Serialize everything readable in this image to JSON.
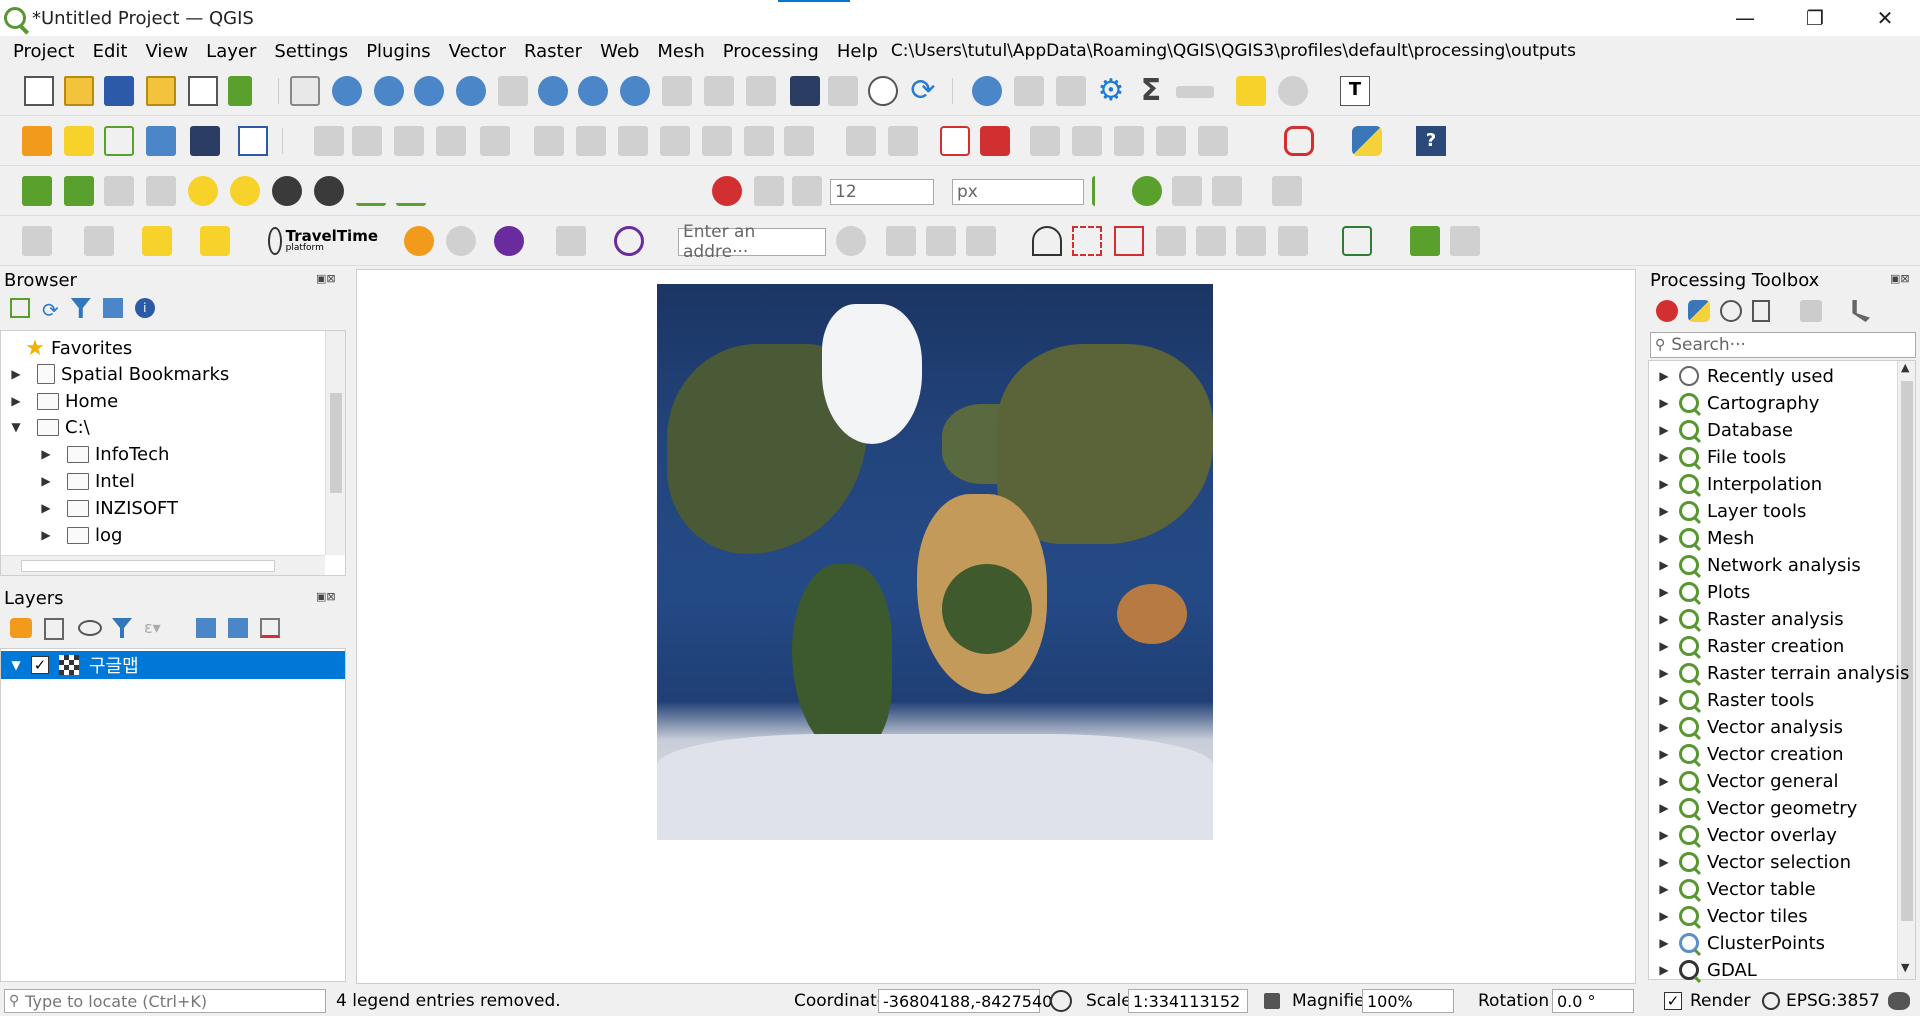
{
  "window": {
    "title": "*Untitled Project — QGIS",
    "minimize": "—",
    "restore": "❐",
    "close": "✕"
  },
  "menu": {
    "items": [
      "Project",
      "Edit",
      "View",
      "Layer",
      "Settings",
      "Plugins",
      "Vector",
      "Raster",
      "Web",
      "Mesh",
      "Processing",
      "Help"
    ],
    "path": "C:\\Users\\tutul\\AppData\\Roaming\\QGIS\\QGIS3\\profiles\\default\\processing\\outputs"
  },
  "toolbar": {
    "snap_value": "12",
    "snap_unit": "px",
    "travel_time_label": "TravelTime",
    "travel_time_sub": "platform",
    "address_placeholder": "Enter an addre···"
  },
  "browser": {
    "title": "Browser",
    "items": [
      {
        "label": "Favorites",
        "icon": "star-icon",
        "level": 0
      },
      {
        "label": "Spatial Bookmarks",
        "icon": "bookmark-icon",
        "level": 0
      },
      {
        "label": "Home",
        "icon": "home-icon",
        "level": 0
      },
      {
        "label": "C:\\",
        "icon": "drive-icon",
        "level": 0
      },
      {
        "label": "InfoTech",
        "icon": "folder-icon",
        "level": 1
      },
      {
        "label": "Intel",
        "icon": "folder-icon",
        "level": 1
      },
      {
        "label": "INZISOFT",
        "icon": "folder-icon",
        "level": 1
      },
      {
        "label": "log",
        "icon": "folder-icon",
        "level": 1
      }
    ]
  },
  "layers": {
    "title": "Layers",
    "items": [
      {
        "label": "구글맵",
        "checked": true
      }
    ]
  },
  "processing": {
    "title": "Processing Toolbox",
    "search_placeholder": "Search···",
    "items": [
      "Recently used",
      "Cartography",
      "Database",
      "File tools",
      "Interpolation",
      "Layer tools",
      "Mesh",
      "Network analysis",
      "Plots",
      "Raster analysis",
      "Raster creation",
      "Raster terrain analysis",
      "Raster tools",
      "Vector analysis",
      "Vector creation",
      "Vector general",
      "Vector geometry",
      "Vector overlay",
      "Vector selection",
      "Vector table",
      "Vector tiles",
      "ClusterPoints",
      "GDAL"
    ]
  },
  "status": {
    "locate_placeholder": "Type to locate (Ctrl+K)",
    "message": "4 legend entries removed.",
    "coordinate_label": "Coordinate",
    "coordinate": "-36804188,-8427540",
    "scale_label": "Scale",
    "scale": "1:334113152",
    "magnifier_label": "Magnifier",
    "magnifier": "100%",
    "rotation_label": "Rotation",
    "rotation": "0.0 °",
    "render_label": "Render",
    "crs": "EPSG:3857"
  },
  "colors": {
    "selection": "#0078d7",
    "qgis_green": "#589632",
    "ocean": "#23457d"
  }
}
